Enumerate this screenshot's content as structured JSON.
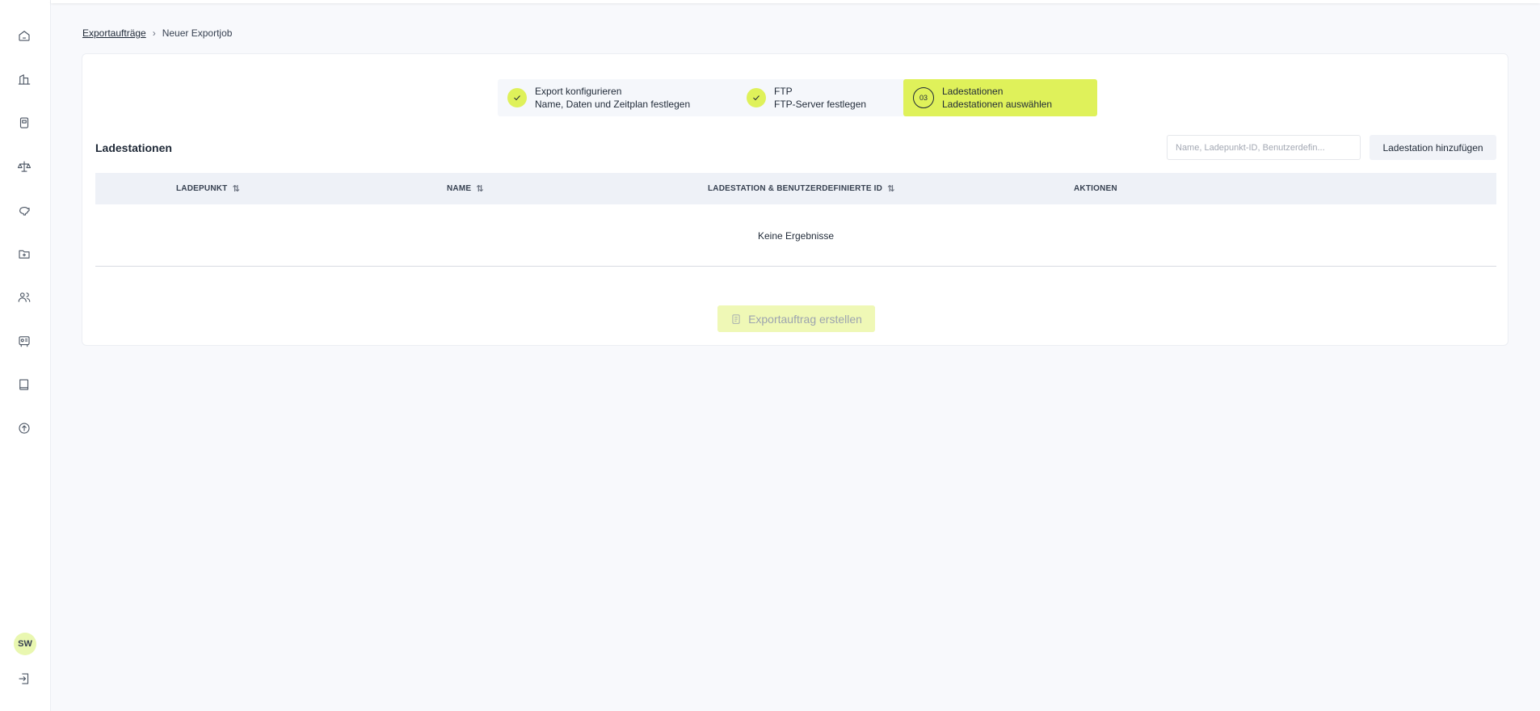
{
  "sidebar": {
    "icons": [
      "home-icon",
      "buildings-icon",
      "charger-icon",
      "scale-icon",
      "piggy-bank-icon",
      "folder-icon",
      "users-icon",
      "vending-icon",
      "book-icon",
      "upload-icon"
    ],
    "avatar_initials": "SW",
    "logout_icon": "logout-icon"
  },
  "breadcrumb": {
    "parent": "Exportaufträge",
    "current": "Neuer Exportjob"
  },
  "stepper": {
    "steps": [
      {
        "title": "Export konfigurieren",
        "subtitle": "Name, Daten und Zeitplan festlegen",
        "state": "done"
      },
      {
        "title": "FTP",
        "subtitle": "FTP-Server festlegen",
        "state": "done"
      },
      {
        "title": "Ladestationen",
        "subtitle": "Ladestationen auswählen",
        "state": "current",
        "number": "03"
      }
    ],
    "accent_color": "#dff15a"
  },
  "section": {
    "title": "Ladestationen",
    "search_placeholder": "Name, Ladepunkt-ID, Benutzerdefin...",
    "add_button_label": "Ladestation hinzufügen"
  },
  "table": {
    "columns": [
      {
        "label": "LADEPUNKT",
        "sortable": true
      },
      {
        "label": "NAME",
        "sortable": true
      },
      {
        "label": "LADESTATION & BENUTZERDEFINIERTE ID",
        "sortable": true
      },
      {
        "label": "AKTIONEN",
        "sortable": false
      }
    ],
    "empty_text": "Keine Ergebnisse"
  },
  "footer": {
    "create_button_label": "Exportauftrag erstellen"
  }
}
